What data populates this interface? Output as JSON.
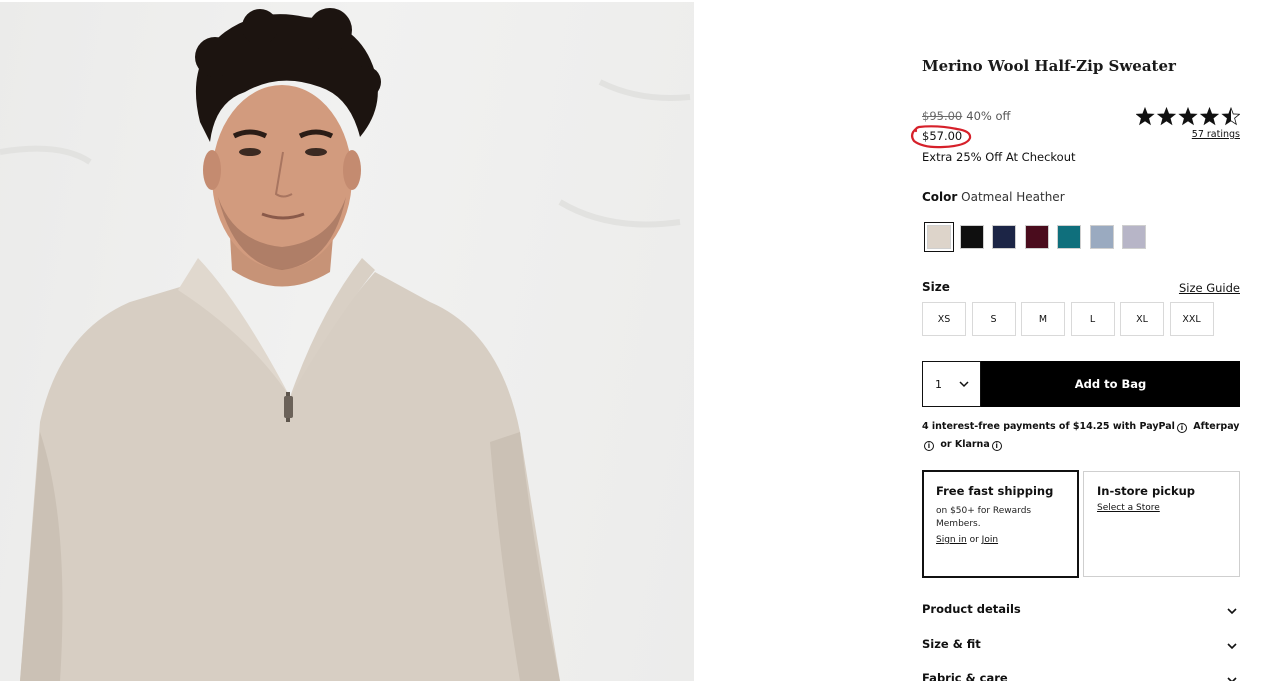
{
  "product": {
    "title": "Merino Wool Half-Zip Sweater",
    "original_price": "$95.00",
    "discount": "40% off",
    "sale_price": "$57.00",
    "promo": "Extra 25% Off At Checkout",
    "rating": 4.5,
    "ratings_link": "57 ratings"
  },
  "color": {
    "label": "Color",
    "selected_name": "Oatmeal Heather",
    "swatches": [
      "#ddd4ca",
      "#0f0f0f",
      "#1c2546",
      "#4a0c1d",
      "#0f6f7c",
      "#9aaac0",
      "#b7b5c7"
    ]
  },
  "size": {
    "label": "Size",
    "guide_link": "Size Guide",
    "options": [
      "XS",
      "S",
      "M",
      "L",
      "XL",
      "XXL"
    ]
  },
  "cart": {
    "quantity": "1",
    "add_label": "Add to Bag"
  },
  "payments": {
    "text": "4 interest-free payments of $14.25 with",
    "paypal": "PayPal",
    "afterpay": "Afterpay",
    "or": "or",
    "klarna": "Klarna",
    "info_glyph": "i"
  },
  "fulfillment": {
    "shipping_title": "Free fast shipping",
    "shipping_sub": "on $50+ for Rewards Members.",
    "sign_in": "Sign in",
    "or": "or",
    "join": "Join",
    "pickup_title": "In-store pickup",
    "pickup_link": "Select a Store"
  },
  "accordions": [
    "Product details",
    "Size & fit",
    "Fabric & care"
  ],
  "colors": {
    "annotation_red": "#d6202a",
    "button_black": "#000000"
  }
}
